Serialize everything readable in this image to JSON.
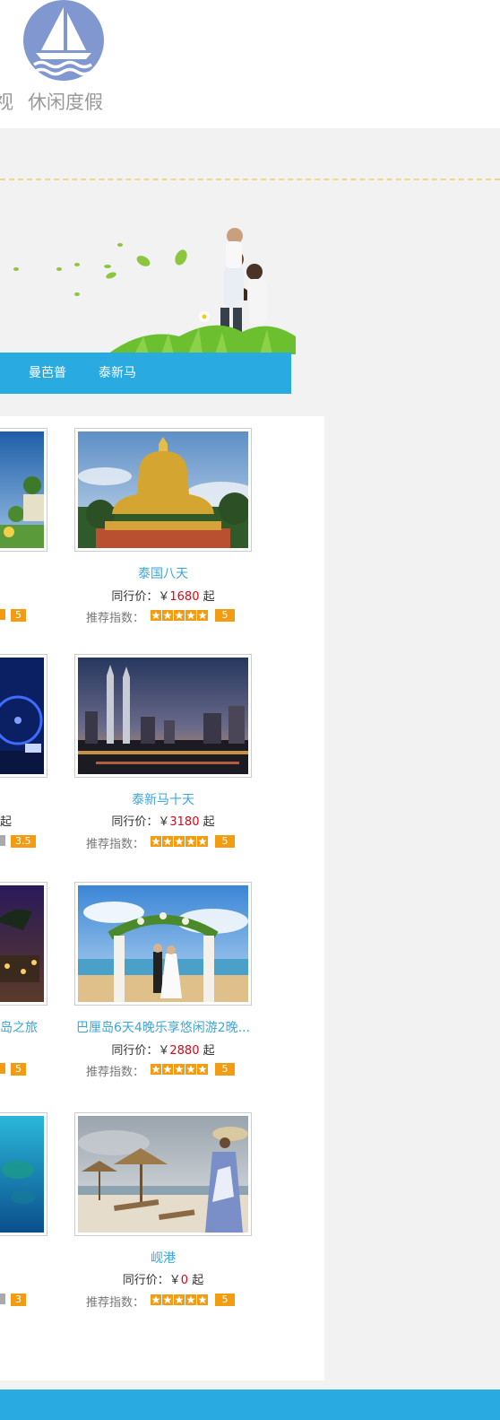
{
  "header": {
    "nav_partial": "视",
    "nav_leisure": "休闲度假"
  },
  "tabs": [
    {
      "label": "曼芭普"
    },
    {
      "label": "泰新马"
    }
  ],
  "products": [
    {
      "name": "泰国八天",
      "price_label": "同行价：",
      "currency": "￥",
      "price": "1680",
      "suffix": "起",
      "rec_label": "推荐指数：",
      "rating": 5,
      "score": "5"
    },
    {
      "name": "泰新马十天",
      "price_label": "同行价：",
      "currency": "￥",
      "price": "3180",
      "suffix": "起",
      "rec_label": "推荐指数：",
      "rating": 5,
      "score": "5"
    },
    {
      "name": "巴厘岛6天4晚乐享悠闲游2晚...",
      "price_label": "同行价：",
      "currency": "￥",
      "price": "2880",
      "suffix": "起",
      "rec_label": "推荐指数：",
      "rating": 5,
      "score": "5"
    },
    {
      "name": "岘港",
      "price_label": "同行价：",
      "currency": "￥",
      "price": "0",
      "suffix": "起",
      "rec_label": "推荐指数：",
      "rating": 5,
      "score": "5"
    }
  ],
  "left_column": [
    {
      "name": "",
      "price_suffix": "",
      "score": "5"
    },
    {
      "name": "",
      "price_suffix": "起",
      "score": "3.5"
    },
    {
      "name": "岛之旅",
      "price_suffix": "",
      "score": "5"
    },
    {
      "name": "",
      "price_suffix": "",
      "score": "3"
    }
  ],
  "colors": {
    "accent_blue": "#29abe2",
    "link_blue": "#3aa6dc",
    "price_red": "#e60012",
    "star_orange": "#f39c12"
  },
  "icons": {
    "logo": "sailboat-icon",
    "star": "star-icon"
  }
}
